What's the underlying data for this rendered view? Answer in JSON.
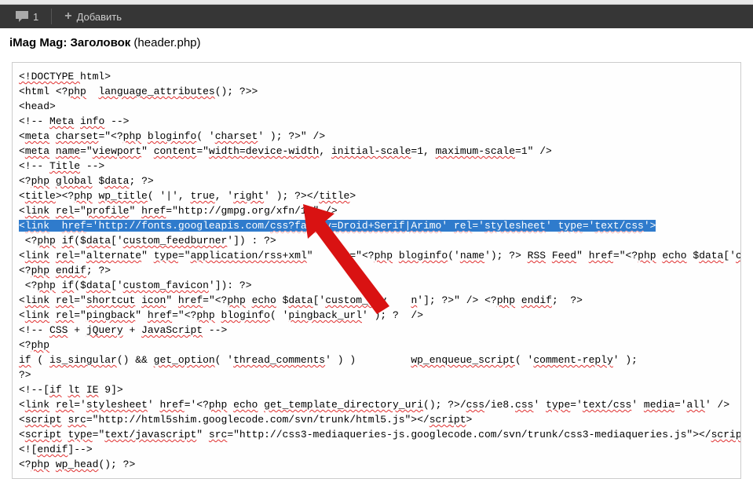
{
  "toolbar": {
    "comment_count": "1",
    "add_label": "Добавить"
  },
  "header": {
    "title_bold": "iMag Mag: Заголовок",
    "title_normal": " (header.php)"
  },
  "code": {
    "lines": [
      [
        [
          "<!DOCTYPE ",
          "wavy"
        ],
        [
          "html",
          ""
        ],
        [
          ">",
          ""
        ]
      ],
      [
        [
          "<",
          ""
        ],
        [
          "html",
          ""
        ],
        [
          " <?",
          ""
        ],
        [
          "php",
          "wavy"
        ],
        [
          "  ",
          ""
        ],
        [
          "language_attributes",
          "wavy"
        ],
        [
          "(); ?>>",
          ""
        ]
      ],
      [
        [
          "<head>",
          ""
        ]
      ],
      [
        [
          "<!-- ",
          ""
        ],
        [
          "Meta",
          "wavy"
        ],
        [
          " ",
          ""
        ],
        [
          "info",
          "wavy"
        ],
        [
          " -->",
          ""
        ]
      ],
      [
        [
          "<",
          ""
        ],
        [
          "meta",
          "wavy"
        ],
        [
          " ",
          ""
        ],
        [
          "charset",
          "wavy"
        ],
        [
          "=\"<?",
          ""
        ],
        [
          "php",
          "wavy"
        ],
        [
          " ",
          ""
        ],
        [
          "bloginfo",
          "wavy"
        ],
        [
          "( '",
          ""
        ],
        [
          "charset",
          "wavy"
        ],
        [
          "' ); ?>\" />",
          ""
        ]
      ],
      [
        [
          "<",
          ""
        ],
        [
          "meta",
          "wavy"
        ],
        [
          " ",
          ""
        ],
        [
          "name",
          "wavy"
        ],
        [
          "=\"",
          ""
        ],
        [
          "viewport",
          "wavy"
        ],
        [
          "\" ",
          ""
        ],
        [
          "content",
          "wavy"
        ],
        [
          "=\"",
          ""
        ],
        [
          "width=device-width",
          "wavy"
        ],
        [
          ", ",
          ""
        ],
        [
          "initial-scale",
          "wavy"
        ],
        [
          "=1, ",
          ""
        ],
        [
          "maximum-scale",
          "wavy"
        ],
        [
          "=1\" />",
          ""
        ]
      ],
      [
        [
          "<!-- ",
          ""
        ],
        [
          "Title",
          "wavy"
        ],
        [
          " -->",
          ""
        ]
      ],
      [
        [
          "<?",
          ""
        ],
        [
          "php",
          "wavy"
        ],
        [
          " ",
          ""
        ],
        [
          "global",
          "wavy"
        ],
        [
          " $",
          ""
        ],
        [
          "data",
          "wavy"
        ],
        [
          "; ?>",
          ""
        ]
      ],
      [
        [
          "",
          ""
        ]
      ],
      [
        [
          "<",
          ""
        ],
        [
          "title",
          "wavy"
        ],
        [
          "><?",
          ""
        ],
        [
          "php",
          "wavy"
        ],
        [
          " ",
          ""
        ],
        [
          "wp_title",
          "wavy"
        ],
        [
          "( '|', ",
          ""
        ],
        [
          "true",
          "wavy"
        ],
        [
          ", '",
          ""
        ],
        [
          "right",
          "wavy"
        ],
        [
          "' ); ?></",
          ""
        ],
        [
          "title",
          "wavy"
        ],
        [
          ">",
          ""
        ]
      ],
      [
        [
          "<",
          ""
        ],
        [
          "link",
          "wavy"
        ],
        [
          " ",
          ""
        ],
        [
          "rel",
          "wavy"
        ],
        [
          "=\"",
          ""
        ],
        [
          "profile",
          "wavy"
        ],
        [
          "\" ",
          ""
        ],
        [
          "href",
          "wavy"
        ],
        [
          "=\"http://gmpg.org/xfn/11\" />",
          ""
        ]
      ],
      [
        [
          "<",
          ""
        ],
        [
          "link",
          "wavy"
        ],
        [
          "  ",
          ""
        ],
        [
          "href",
          "wavy"
        ],
        [
          "='http://fonts.googleapis.com/",
          ""
        ],
        [
          "css?family=Droid+Serif|Arimo",
          "wavy"
        ],
        [
          "' ",
          ""
        ],
        [
          "rel",
          "wavy"
        ],
        [
          "='",
          ""
        ],
        [
          "stylesheet",
          "wavy"
        ],
        [
          "' ",
          ""
        ],
        [
          "type",
          "wavy"
        ],
        [
          "='",
          ""
        ],
        [
          "text/css",
          "wavy"
        ],
        [
          "'>",
          ""
        ]
      ],
      [
        [
          " <?",
          ""
        ],
        [
          "php",
          "wavy"
        ],
        [
          " ",
          ""
        ],
        [
          "if",
          "wavy"
        ],
        [
          "($",
          ""
        ],
        [
          "data",
          "wavy"
        ],
        [
          "['",
          ""
        ],
        [
          "custom_feedburner",
          "wavy"
        ],
        [
          "']) : ?>",
          ""
        ]
      ],
      [
        [
          "<",
          ""
        ],
        [
          "link",
          "wavy"
        ],
        [
          " ",
          ""
        ],
        [
          "rel",
          "wavy"
        ],
        [
          "=\"",
          ""
        ],
        [
          "alternate",
          "wavy"
        ],
        [
          "\" ",
          ""
        ],
        [
          "type",
          "wavy"
        ],
        [
          "=\"",
          ""
        ],
        [
          "application/rss+xml",
          "wavy"
        ],
        [
          "\"    ",
          ""
        ],
        [
          "le",
          ""
        ],
        [
          "=\"<?",
          ""
        ],
        [
          "php",
          "wavy"
        ],
        [
          " ",
          ""
        ],
        [
          "bloginfo",
          "wavy"
        ],
        [
          "('",
          ""
        ],
        [
          "name",
          "wavy"
        ],
        [
          "'); ?> ",
          ""
        ],
        [
          "RSS",
          "wavy"
        ],
        [
          " ",
          ""
        ],
        [
          "Feed",
          "wavy"
        ],
        [
          "\" ",
          ""
        ],
        [
          "href",
          "wavy"
        ],
        [
          "=\"<?",
          ""
        ],
        [
          "php",
          "wavy"
        ],
        [
          " ",
          ""
        ],
        [
          "echo",
          "wavy"
        ],
        [
          " $",
          ""
        ],
        [
          "data",
          "wavy"
        ],
        [
          "['",
          ""
        ],
        [
          "custom_feedburner",
          "wavy"
        ],
        [
          "'",
          ""
        ]
      ],
      [
        [
          "<?",
          ""
        ],
        [
          "php",
          "wavy"
        ],
        [
          " ",
          ""
        ],
        [
          "endif",
          "wavy"
        ],
        [
          "; ?>",
          ""
        ]
      ],
      [
        [
          " <?",
          ""
        ],
        [
          "php",
          "wavy"
        ],
        [
          " ",
          ""
        ],
        [
          "if",
          "wavy"
        ],
        [
          "($",
          ""
        ],
        [
          "data",
          "wavy"
        ],
        [
          "['",
          ""
        ],
        [
          "custom_favicon",
          "wavy"
        ],
        [
          "']): ?>",
          ""
        ]
      ],
      [
        [
          "<",
          ""
        ],
        [
          "link",
          "wavy"
        ],
        [
          " ",
          ""
        ],
        [
          "rel",
          "wavy"
        ],
        [
          "=\"",
          ""
        ],
        [
          "shortcut",
          "wavy"
        ],
        [
          " ",
          ""
        ],
        [
          "icon",
          "wavy"
        ],
        [
          "\" ",
          ""
        ],
        [
          "href",
          "wavy"
        ],
        [
          "=\"<?",
          ""
        ],
        [
          "php",
          "wavy"
        ],
        [
          " ",
          ""
        ],
        [
          "echo",
          "wavy"
        ],
        [
          " $",
          ""
        ],
        [
          "data",
          "wavy"
        ],
        [
          "['",
          ""
        ],
        [
          "custom_fav",
          "wavy"
        ],
        [
          "    ",
          ""
        ],
        [
          "n",
          "wavy"
        ],
        [
          "']; ?>\" /> <?",
          ""
        ],
        [
          "php",
          "wavy"
        ],
        [
          " ",
          ""
        ],
        [
          "endif",
          "wavy"
        ],
        [
          ";  ?>",
          ""
        ]
      ],
      [
        [
          "<",
          ""
        ],
        [
          "link",
          "wavy"
        ],
        [
          " ",
          ""
        ],
        [
          "rel",
          "wavy"
        ],
        [
          "=\"",
          ""
        ],
        [
          "pingback",
          "wavy"
        ],
        [
          "\" ",
          ""
        ],
        [
          "href",
          "wavy"
        ],
        [
          "=\"<?",
          ""
        ],
        [
          "php",
          "wavy"
        ],
        [
          " ",
          ""
        ],
        [
          "bloginfo",
          "wavy"
        ],
        [
          "( '",
          ""
        ],
        [
          "pingback_url",
          "wavy"
        ],
        [
          "' ); ?",
          ""
        ],
        [
          "  />",
          ""
        ]
      ],
      [
        [
          "",
          ""
        ]
      ],
      [
        [
          "<!-- ",
          ""
        ],
        [
          "CSS",
          "wavy"
        ],
        [
          " + ",
          ""
        ],
        [
          "jQuery",
          "wavy"
        ],
        [
          " + ",
          ""
        ],
        [
          "JavaScript",
          "wavy"
        ],
        [
          " -->",
          ""
        ]
      ],
      [
        [
          "<?",
          ""
        ],
        [
          "php",
          "wavy"
        ],
        [
          "",
          ""
        ]
      ],
      [
        [
          "if",
          "wavy"
        ],
        [
          " ( ",
          ""
        ],
        [
          "is_singular",
          "wavy"
        ],
        [
          "() && ",
          ""
        ],
        [
          "get_option",
          "wavy"
        ],
        [
          "( '",
          ""
        ],
        [
          "thread_comments",
          "wavy"
        ],
        [
          "' ) )         ",
          ""
        ],
        [
          "wp_enqueue_script",
          "wavy"
        ],
        [
          "( '",
          ""
        ],
        [
          "comment-reply",
          "wavy"
        ],
        [
          "' );",
          ""
        ]
      ],
      [
        [
          "",
          ""
        ]
      ],
      [
        [
          "?>",
          ""
        ]
      ],
      [
        [
          "<!--[",
          ""
        ],
        [
          "if",
          "wavy"
        ],
        [
          " ",
          ""
        ],
        [
          "lt",
          "wavy"
        ],
        [
          " ",
          ""
        ],
        [
          "IE",
          "wavy"
        ],
        [
          " 9]>",
          ""
        ]
      ],
      [
        [
          "<",
          ""
        ],
        [
          "link",
          "wavy"
        ],
        [
          " ",
          ""
        ],
        [
          "rel",
          "wavy"
        ],
        [
          "='",
          ""
        ],
        [
          "stylesheet",
          "wavy"
        ],
        [
          "' ",
          ""
        ],
        [
          "href",
          "wavy"
        ],
        [
          "='<?",
          ""
        ],
        [
          "php",
          "wavy"
        ],
        [
          " ",
          ""
        ],
        [
          "echo",
          "wavy"
        ],
        [
          " ",
          ""
        ],
        [
          "get_template_directory_uri",
          "wavy"
        ],
        [
          "(); ?>/",
          ""
        ],
        [
          "css",
          "wavy"
        ],
        [
          "/ie8.",
          ""
        ],
        [
          "css",
          "wavy"
        ],
        [
          "' ",
          ""
        ],
        [
          "type",
          "wavy"
        ],
        [
          "='",
          ""
        ],
        [
          "text/css",
          "wavy"
        ],
        [
          "' ",
          ""
        ],
        [
          "media",
          "wavy"
        ],
        [
          "='",
          ""
        ],
        [
          "all",
          "wavy"
        ],
        [
          "' />",
          ""
        ]
      ],
      [
        [
          "<",
          ""
        ],
        [
          "script",
          "wavy"
        ],
        [
          " ",
          ""
        ],
        [
          "src",
          "wavy"
        ],
        [
          "=\"http://html5shim.googlecode.com/svn/trunk/html5.js\"></",
          ""
        ],
        [
          "script",
          "wavy"
        ],
        [
          ">",
          ""
        ]
      ],
      [
        [
          "<",
          ""
        ],
        [
          "script",
          "wavy"
        ],
        [
          " ",
          ""
        ],
        [
          "type",
          "wavy"
        ],
        [
          "=\"",
          ""
        ],
        [
          "text/javascript",
          "wavy"
        ],
        [
          "\" ",
          ""
        ],
        [
          "src",
          "wavy"
        ],
        [
          "=\"http://css3-mediaqueries-js.googlecode.com/svn/trunk/css3-mediaqueries.js\"></",
          ""
        ],
        [
          "script",
          "wavy"
        ],
        [
          ">",
          ""
        ]
      ],
      [
        [
          "<![",
          ""
        ],
        [
          "endif",
          "wavy"
        ],
        [
          "]-->",
          ""
        ]
      ],
      [
        [
          "<?",
          ""
        ],
        [
          "php",
          "wavy"
        ],
        [
          " ",
          ""
        ],
        [
          "wp_head",
          "wavy"
        ],
        [
          "(); ?>",
          ""
        ]
      ]
    ],
    "highlighted_index": 11
  }
}
